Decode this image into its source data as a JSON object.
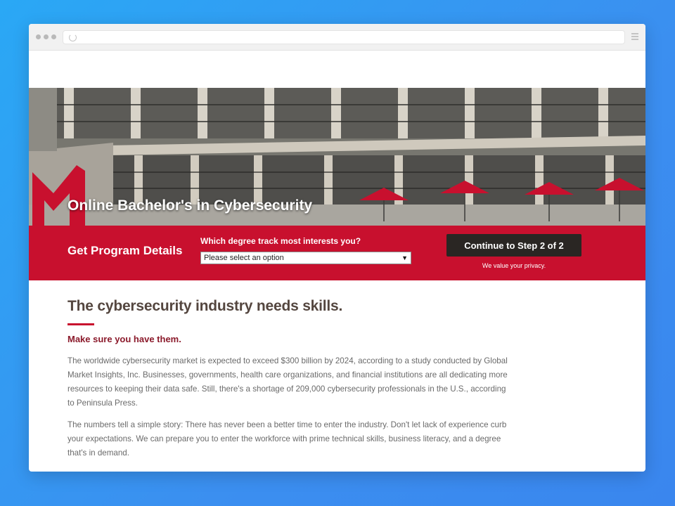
{
  "hero": {
    "title": "Online Bachelor's in Cybersecurity"
  },
  "form": {
    "heading": "Get Program Details",
    "question": "Which degree track most interests you?",
    "select_value": "Please select an option",
    "cta_label": "Continue to Step 2 of 2",
    "privacy_note": "We value your privacy."
  },
  "content": {
    "heading": "The cybersecurity industry needs skills.",
    "subheading": "Make sure you have them.",
    "paragraphs": [
      "The worldwide cybersecurity market is expected to exceed $300 billion by 2024, according to a study conducted by Global Market Insights, Inc. Businesses, governments, health care organizations, and financial institutions are all dedicating more resources to keeping their data safe. Still, there's a shortage of 209,000 cybersecurity professionals in the U.S., according to Peninsula Press.",
      "The numbers tell a simple story: There has never been a better time to enter the industry. Don't let lack of experience curb your expectations. We can prepare you to enter the workforce with prime technical skills, business literacy, and a degree that's in demand."
    ]
  },
  "colors": {
    "brand_red": "#c8102e",
    "cta_dark": "#2a2623",
    "background": "#3b8ff0"
  },
  "icons": [
    "reload-icon",
    "menu-icon",
    "logo-m-icon",
    "chevron-down-icon"
  ]
}
